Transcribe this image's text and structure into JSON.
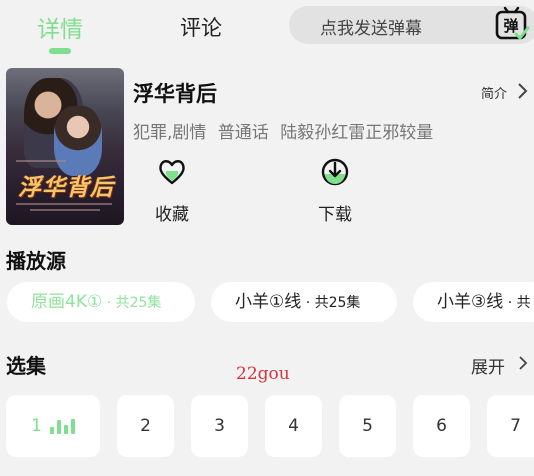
{
  "tabs": {
    "detail": "详情",
    "comment": "评论"
  },
  "danmaku": {
    "placeholder": "点我发送弹幕",
    "icon_label": "弹"
  },
  "show": {
    "title": "浮华背后",
    "intro_label": "简介",
    "genres": "犯罪,剧情",
    "language": "普通话",
    "cast": "陆毅孙红雷正邪较量",
    "poster_title": "浮华背后"
  },
  "actions": {
    "favorite": "收藏",
    "download": "下载"
  },
  "sources": {
    "title": "播放源",
    "items": [
      {
        "name": "原画4K①",
        "count": " · 共25集"
      },
      {
        "name": "小羊①线",
        "count": " · 共25集"
      },
      {
        "name": "小羊③线",
        "count": " · 共"
      }
    ]
  },
  "episodes": {
    "title": "选集",
    "expand_label": "展开",
    "items": [
      "1",
      "2",
      "3",
      "4",
      "5",
      "6",
      "7"
    ]
  },
  "watermark": "22gou",
  "colors": {
    "accent": "#7ee08c",
    "background": "#f2f2f2",
    "watermark": "#d8343a"
  }
}
